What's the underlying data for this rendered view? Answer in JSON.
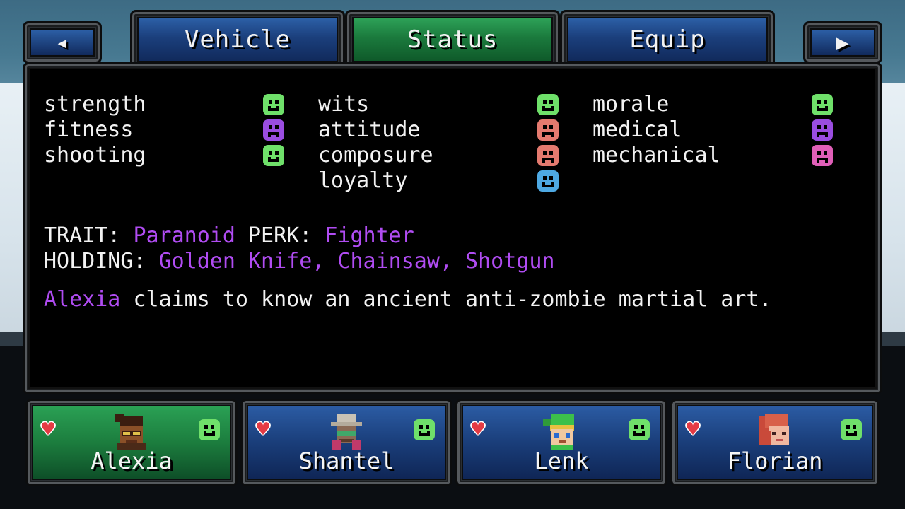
{
  "nav": {
    "back_icon": "back-arrow-icon",
    "next_icon": "next-arrow-icon",
    "back_glyph": "◂",
    "next_glyph": "▶",
    "tabs": [
      {
        "label": "Vehicle",
        "active": false
      },
      {
        "label": "Status",
        "active": true
      },
      {
        "label": "Equip",
        "active": false
      }
    ]
  },
  "stats": {
    "columns": [
      [
        {
          "label": "strength",
          "mood": "happy",
          "color": "#6fe06a"
        },
        {
          "label": "fitness",
          "mood": "sad",
          "color": "#9a4de0"
        },
        {
          "label": "shooting",
          "mood": "happy",
          "color": "#6fe06a"
        }
      ],
      [
        {
          "label": "wits",
          "mood": "happy",
          "color": "#6fe06a"
        },
        {
          "label": "attitude",
          "mood": "x",
          "color": "#e47a6f"
        },
        {
          "label": "composure",
          "mood": "x",
          "color": "#e47a6f"
        },
        {
          "label": "loyalty",
          "mood": "happy",
          "color": "#4ea9e3"
        }
      ],
      [
        {
          "label": "morale",
          "mood": "happy",
          "color": "#6fe06a"
        },
        {
          "label": "medical",
          "mood": "sad",
          "color": "#9a4de0"
        },
        {
          "label": "mechanical",
          "mood": "sad",
          "color": "#e05fb8"
        }
      ]
    ]
  },
  "details": {
    "trait_label": "TRAIT:",
    "trait_value": "Paranoid",
    "perk_label": "PERK:",
    "perk_value": "Fighter",
    "holding_label": "HOLDING:",
    "holding_value": "Golden Knife, Chainsaw, Shotgun",
    "bio_name": "Alexia",
    "bio_text": "claims to know an ancient anti-zombie martial art."
  },
  "party": [
    {
      "name": "Alexia",
      "selected": true,
      "mood": "happy",
      "mood_color": "#6fe06a"
    },
    {
      "name": "Shantel",
      "selected": false,
      "mood": "happy",
      "mood_color": "#6fe06a"
    },
    {
      "name": "Lenk",
      "selected": false,
      "mood": "happy",
      "mood_color": "#6fe06a"
    },
    {
      "name": "Florian",
      "selected": false,
      "mood": "happy",
      "mood_color": "#6fe06a"
    }
  ],
  "colors": {
    "accent_purple": "#b04cf2",
    "tab_active": "#1b7a3d",
    "tab_inactive": "#1b3f7c"
  }
}
